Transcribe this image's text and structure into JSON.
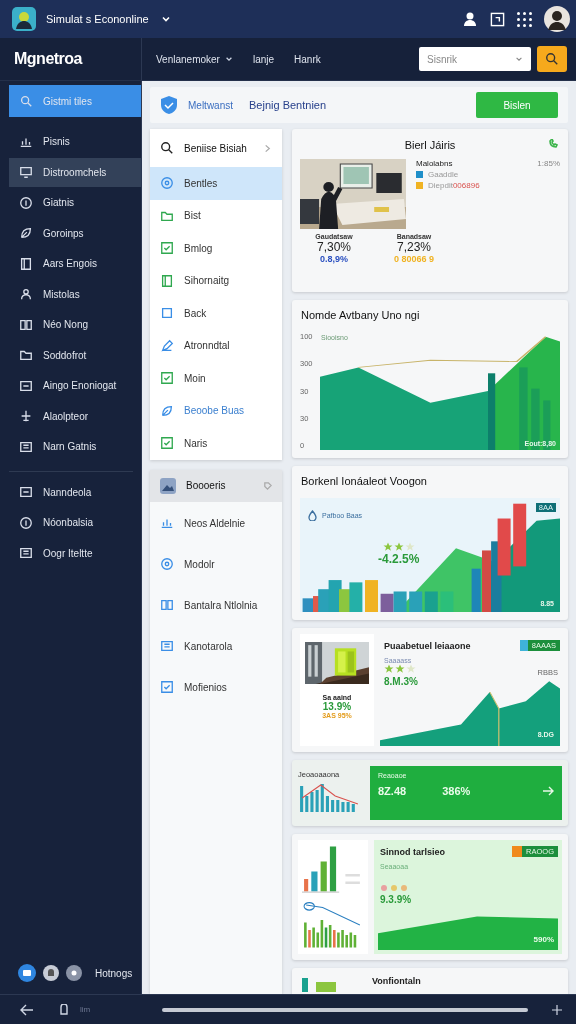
{
  "top_bar": {
    "app_title": "Simulat s Econonline"
  },
  "header": {
    "logo": "Mgnetroa",
    "nav": [
      {
        "label": "Venlanemoker",
        "dropdown": true
      },
      {
        "label": "lanje",
        "dropdown": false
      },
      {
        "label": "Hanrk",
        "dropdown": false
      }
    ],
    "search": {
      "placeholder": "Sisnrik"
    }
  },
  "sidebar": {
    "items": [
      {
        "label": "Gistmi tiles",
        "selected": true,
        "highlighted": false
      },
      {
        "label": "Pisnis",
        "selected": false,
        "highlighted": false
      },
      {
        "label": "Distroomchels",
        "selected": false,
        "highlighted": true
      },
      {
        "label": "Giatnis",
        "selected": false,
        "highlighted": false
      },
      {
        "label": "Goroinps",
        "selected": false,
        "highlighted": false
      },
      {
        "label": "Aars Engois",
        "selected": false,
        "highlighted": false
      },
      {
        "label": "Mistolas",
        "selected": false,
        "highlighted": false
      },
      {
        "label": "Néo Nong",
        "selected": false,
        "highlighted": false
      },
      {
        "label": "Soddofrot",
        "selected": false,
        "highlighted": false
      },
      {
        "label": "Aingo Enoniogat",
        "selected": false,
        "highlighted": false
      },
      {
        "label": "Alaolpteor",
        "selected": false,
        "highlighted": false
      },
      {
        "label": "Narn Gatnis",
        "selected": false,
        "highlighted": false
      }
    ],
    "bottom_items": [
      {
        "label": "Nanndeola"
      },
      {
        "label": "Nóonbalsia"
      },
      {
        "label": "Oogr Iteltte"
      }
    ],
    "footer_label": "Hotnogs"
  },
  "toolbar": {
    "label": "Meltwanst",
    "title": "Bejnig Bentnien",
    "button": "Bislen"
  },
  "panels": [
    {
      "title": "Beniise Bisiah",
      "shaded": false,
      "items": [
        {
          "label": "Bentles",
          "selected": true,
          "accent": false
        },
        {
          "label": "Bist",
          "selected": false,
          "accent": false
        },
        {
          "label": "Bmlog",
          "selected": false,
          "accent": false
        },
        {
          "label": "Sihornaitg",
          "selected": false,
          "accent": false
        },
        {
          "label": "Back",
          "selected": false,
          "accent": false
        },
        {
          "label": "Atronndtal",
          "selected": false,
          "accent": false
        },
        {
          "label": "Moin",
          "selected": false,
          "accent": false
        },
        {
          "label": "Beoobe Buas",
          "selected": false,
          "accent": true
        },
        {
          "label": "Naris",
          "selected": false,
          "accent": false
        }
      ]
    },
    {
      "title": "Boooeris",
      "shaded": true,
      "items": [
        {
          "label": "Neos Aldelnie",
          "selected": false,
          "accent": false
        },
        {
          "label": "Modolr",
          "selected": false,
          "accent": false
        },
        {
          "label": "Bantalra Ntlolnia",
          "selected": false,
          "accent": false
        },
        {
          "label": "Kanotarola",
          "selected": false,
          "accent": false
        },
        {
          "label": "Mofienios",
          "selected": false,
          "accent": false
        }
      ]
    }
  ],
  "summary": {
    "title": "Bierl Jáiris",
    "legend_title": "Malolabns",
    "legend_value": "1:85%",
    "legend": [
      {
        "label": "Gaaddle",
        "color": "#1f8fc9"
      },
      {
        "label": "Diepdit",
        "value": "006896",
        "color": "#f0b323"
      }
    ],
    "stats": [
      {
        "label": "Gaudatsaw",
        "value": "7,30%",
        "sub": "0.8,9%",
        "color": "#2a4fc0"
      },
      {
        "label": "Banadsaw",
        "value": "7,23%",
        "sub": "0 80066 9",
        "color": "#f0b323"
      }
    ]
  },
  "trend": {
    "title": "Nomde Avtbany Uno ngi",
    "axis_labels": [
      "100",
      "300",
      "30",
      "30",
      "0"
    ],
    "series_label": "Siooisno",
    "value_label": "Eout:8,80"
  },
  "growth": {
    "title": "Borkenl Ionáaleot Voogon",
    "label": "Pafboo Baas",
    "stars": 2,
    "change": "-4.2.5%",
    "value": "8.85",
    "tag": "8AA"
  },
  "product": {
    "title": "Puaabetuel leiaaone",
    "tag": "8AAAS",
    "subtitle": "Saaaass",
    "stars": 2,
    "change": "8.M.3%",
    "value": "8.DG",
    "peak_label": "RBBS",
    "side_label": "Sa aaind",
    "side_value": "13.9%",
    "side_badge": "3AS 95%"
  },
  "kpi": {
    "chart_label": "Jeoaoaaona",
    "label": "Reaoaoe",
    "value": "8Z.48",
    "percent": "386%"
  },
  "promo": {
    "title": "Sinnod tarlsieo",
    "tag": "RAOOG",
    "subtitle": "Seaaoaa",
    "change": "9.3.9%",
    "value": "590%"
  },
  "last": {
    "title": "Vonfiontaln"
  },
  "bottom_bar": {
    "text": "lim"
  }
}
